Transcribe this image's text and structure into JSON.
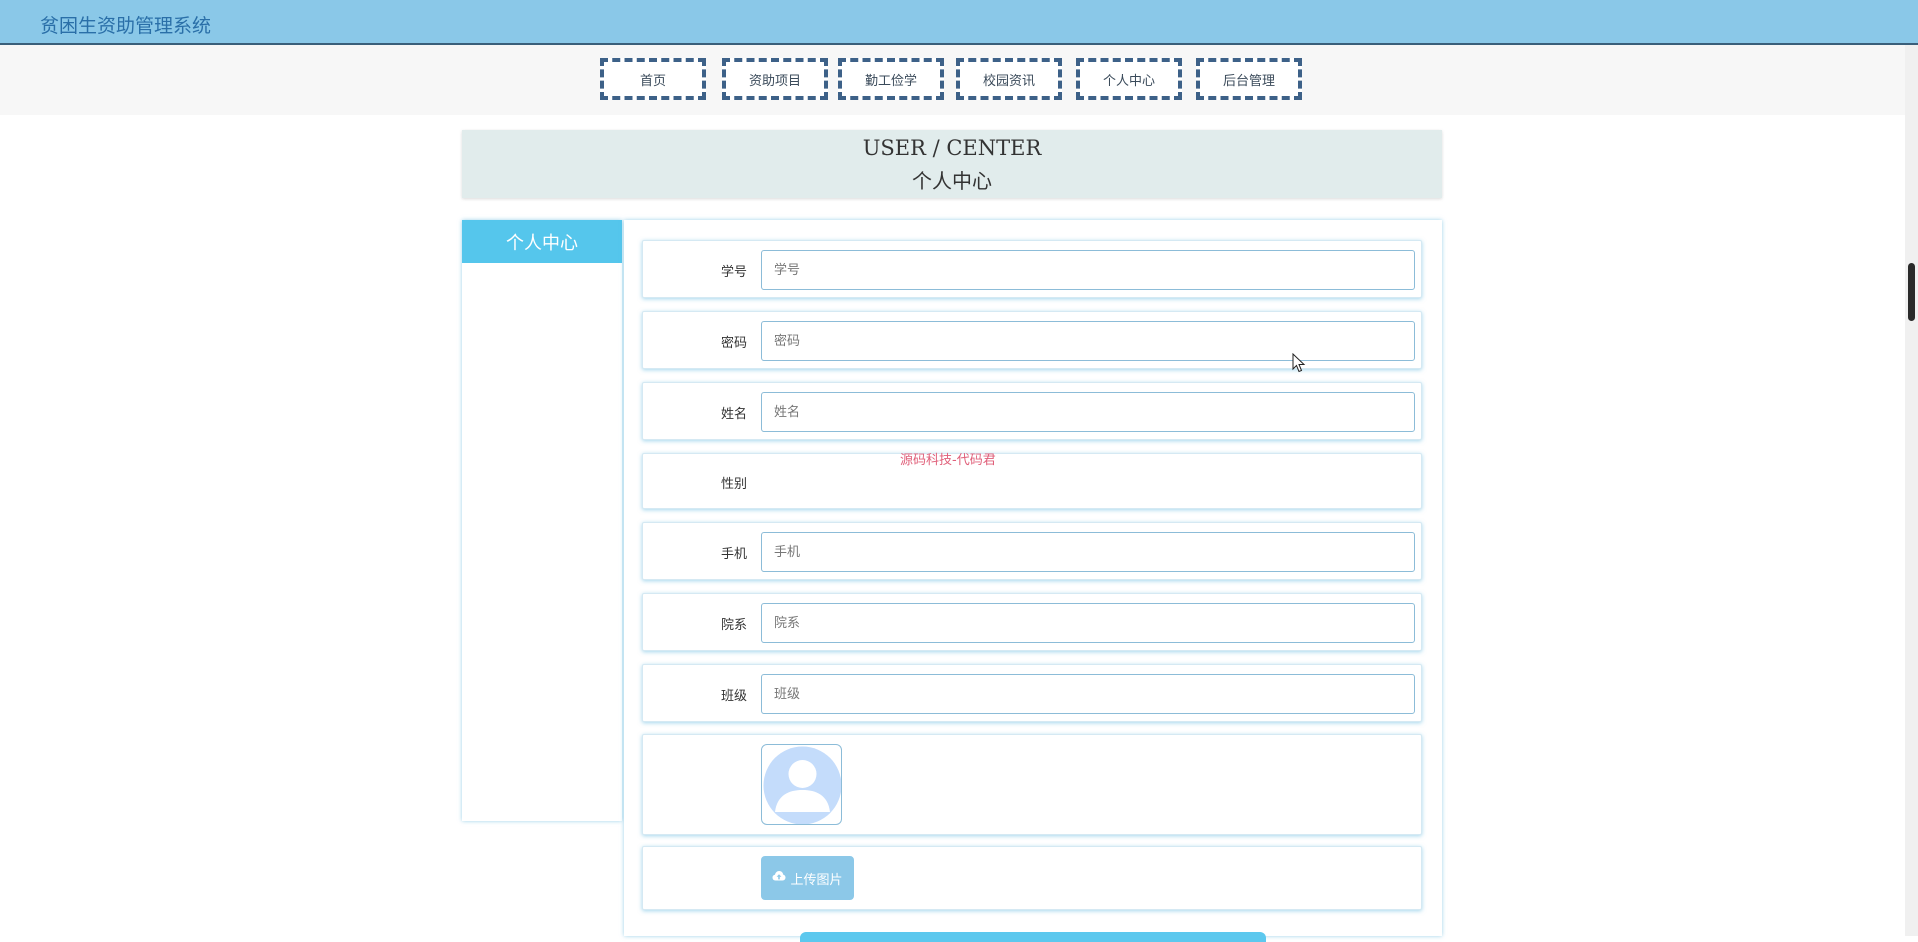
{
  "app": {
    "title": "贫困生资助管理系统"
  },
  "nav": {
    "items": [
      {
        "label": "首页"
      },
      {
        "label": "资助项目"
      },
      {
        "label": "勤工俭学"
      },
      {
        "label": "校园资讯"
      },
      {
        "label": "个人中心"
      },
      {
        "label": "后台管理"
      }
    ]
  },
  "banner": {
    "en": "USER / CENTER",
    "zh": "个人中心"
  },
  "sidebar": {
    "title": "个人中心"
  },
  "form": {
    "student_id": {
      "label": "学号",
      "placeholder": "学号",
      "value": ""
    },
    "password": {
      "label": "密码",
      "placeholder": "密码",
      "value": ""
    },
    "name": {
      "label": "姓名",
      "placeholder": "姓名",
      "value": ""
    },
    "gender": {
      "label": "性别"
    },
    "phone": {
      "label": "手机",
      "placeholder": "手机",
      "value": ""
    },
    "department": {
      "label": "院系",
      "placeholder": "院系",
      "value": ""
    },
    "class": {
      "label": "班级",
      "placeholder": "班级",
      "value": ""
    },
    "upload_label": "上传图片"
  },
  "watermark": "源码科技-代码君",
  "icons": {
    "upload": "cloud-upload-icon",
    "avatar": "user-avatar-icon",
    "cursor": "mouse-pointer-icon"
  },
  "colors": {
    "header_bg": "#8ac8e8",
    "accent": "#55c6ec",
    "nav_border": "#3d6188",
    "upload_button": "#8cc8e8"
  }
}
